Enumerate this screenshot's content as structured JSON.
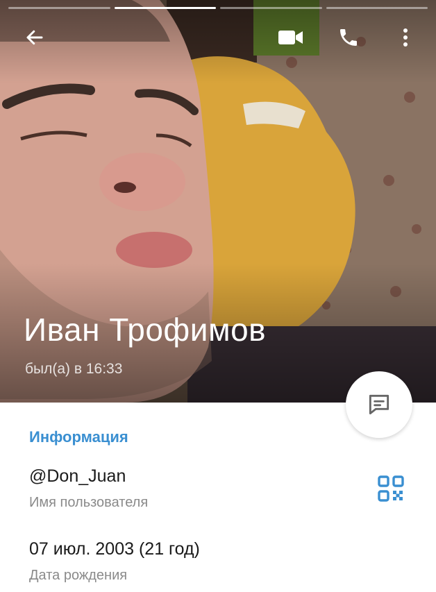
{
  "profile": {
    "name": "Иван Трофимов",
    "status": "был(а) в 16:33"
  },
  "toolbar": {
    "back_icon": "arrow-left-icon",
    "video_icon": "video-camera-icon",
    "call_icon": "phone-icon",
    "menu_icon": "more-vertical-icon"
  },
  "story_bars": {
    "count": 4,
    "active_index": 1
  },
  "fab": {
    "icon": "message-icon"
  },
  "info": {
    "section_title": "Информация",
    "username_value": "@Don_Juan",
    "username_label": "Имя пользователя",
    "birthday_value": "07 июл. 2003 (21 год)",
    "birthday_label": "Дата рождения",
    "qr_icon": "qr-code-icon"
  },
  "colors": {
    "accent": "#3a8fd1",
    "text_primary": "#1a1a1a",
    "text_secondary": "#8a8a8a"
  }
}
